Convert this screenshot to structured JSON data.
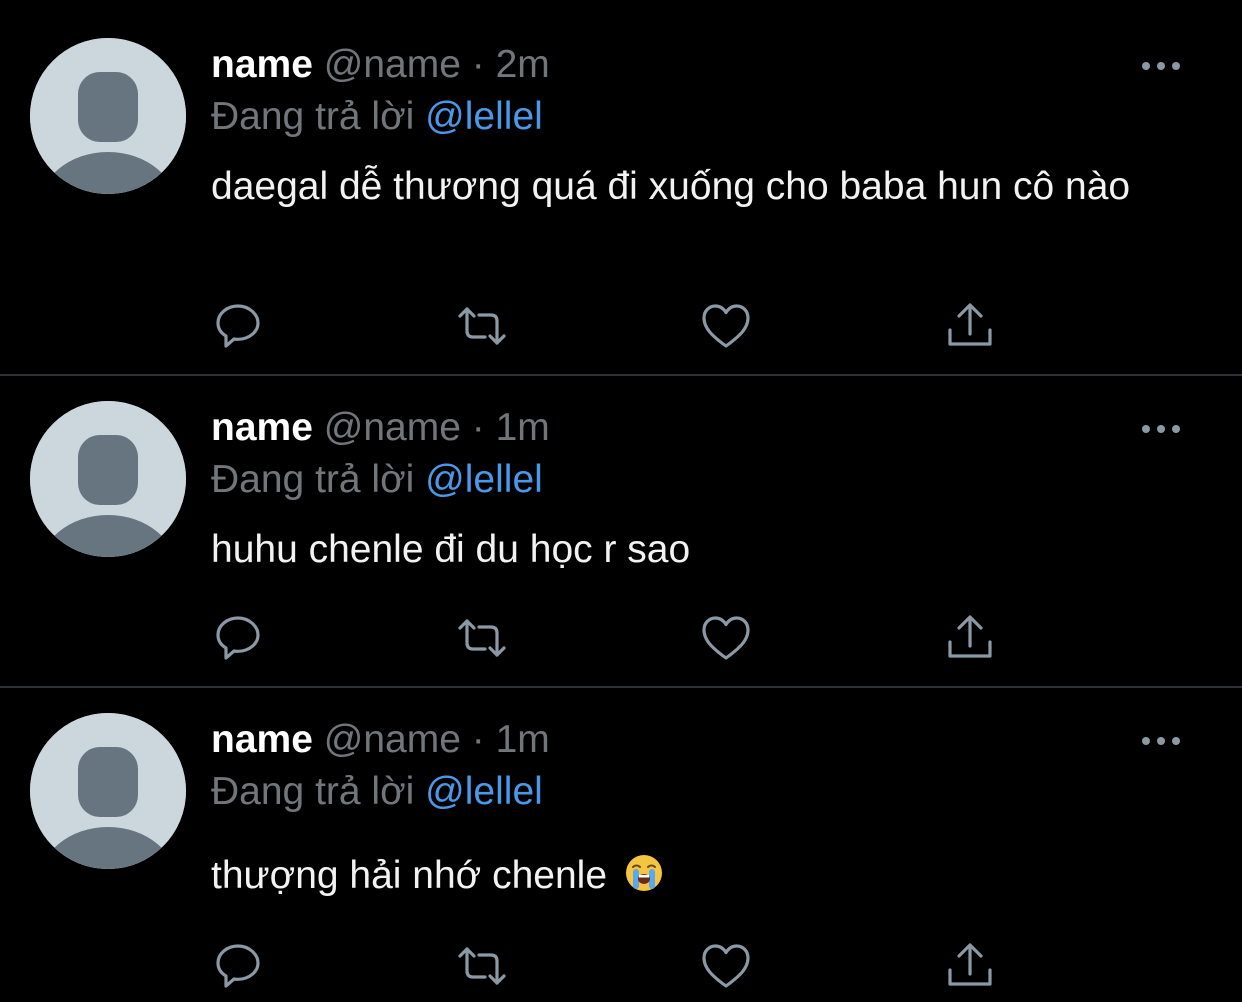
{
  "colors": {
    "background": "#000000",
    "text": "#f2f2f2",
    "muted": "#71767b",
    "mention": "#4a99e9",
    "divider": "#2f3336",
    "avatar_bg": "#ccd6dd",
    "avatar_fg": "#66757f"
  },
  "tweets": [
    {
      "name": "name",
      "handle": "@name",
      "separator": "·",
      "time": "2m",
      "reply_prefix": "Đang trả lời",
      "reply_to": "@lellel",
      "text": "daegal dễ thương quá đi xuống cho baba hun cô nào",
      "emoji": ""
    },
    {
      "name": "name",
      "handle": "@name",
      "separator": "·",
      "time": "1m",
      "reply_prefix": "Đang trả lời",
      "reply_to": "@lellel",
      "text": "huhu chenle đi du học r sao",
      "emoji": ""
    },
    {
      "name": "name",
      "handle": "@name",
      "separator": "·",
      "time": "1m",
      "reply_prefix": "Đang trả lời",
      "reply_to": "@lellel",
      "text": "thượng hải nhớ chenle",
      "emoji": "loudly-crying-face"
    }
  ],
  "actions": [
    "reply-icon",
    "retweet-icon",
    "like-icon",
    "share-icon"
  ],
  "more_icon": "more-options-icon"
}
